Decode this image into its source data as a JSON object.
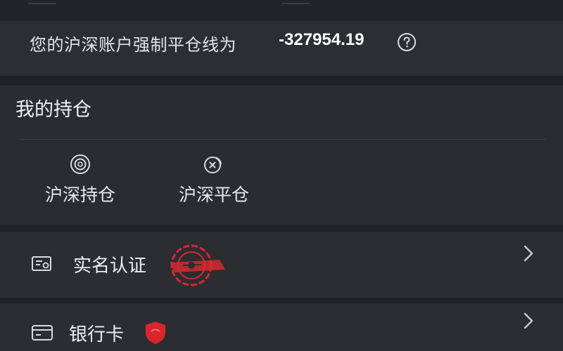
{
  "liquidation": {
    "label": "您的沪深账户强制平仓线为",
    "value": "-327954.19",
    "help_icon": "question-circle-icon"
  },
  "holdings": {
    "title": "我的持仓",
    "actions": [
      {
        "label": "沪深持仓",
        "icon": "target-circle-icon"
      },
      {
        "label": "沪深平仓",
        "icon": "coin-stack-icon"
      }
    ]
  },
  "settings": {
    "items": [
      {
        "label": "实名认证",
        "icon": "id-card-icon",
        "badge": "stamp-seal-icon"
      },
      {
        "label": "银行卡",
        "icon": "bank-card-icon",
        "badge": "red-shield-icon"
      }
    ]
  },
  "colors": {
    "background": "#25272b",
    "panel": "#2b2d31",
    "text": "#e6e7e9",
    "badge_red": "#d8262c"
  }
}
